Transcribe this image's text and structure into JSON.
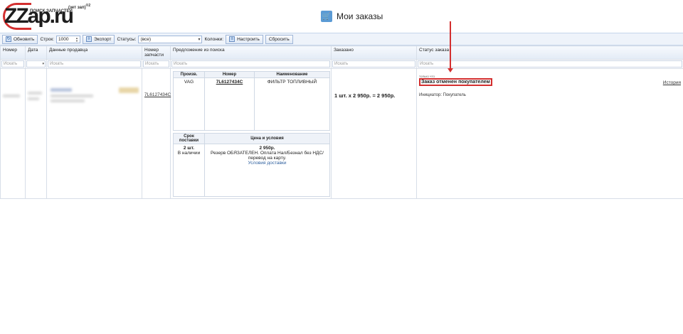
{
  "logo": {
    "brand": "ZZap.ru",
    "tagline": "ПОИСК ЗАПЧАСТЕЙ",
    "zet": "(зет зап)",
    "superscript": "®2"
  },
  "page": {
    "title": "Мои заказы",
    "cart_icon": "cart-icon"
  },
  "toolbar": {
    "refresh_label": "Обновить",
    "rows_label": "Строк:",
    "rows_value": "1000",
    "export_label": "Экспорт",
    "statuses_label": "Статусы:",
    "statuses_value": "(все)",
    "columns_label": "Колонки:",
    "configure_label": "Настроить",
    "reset_label": "Сбросить"
  },
  "table": {
    "headers": {
      "number": "Номер",
      "date": "Дата",
      "seller": "Данные продавца",
      "part_number": "Номер запчасти",
      "offer": "Предложение из поиска",
      "ordered": "Заказано",
      "status": "Статус заказа"
    },
    "filter_placeholder": "Искать",
    "row": {
      "part_number": "7L6127434C",
      "offer": {
        "h_brand": "Произв.",
        "h_number": "Номер",
        "h_name": "Наименование",
        "brand": "VAG",
        "number": "7L6127434C",
        "name": "ФИЛЬТР ТОПЛИВНЫЙ",
        "h_delivery": "Срок поставки",
        "h_price": "Цена и условия",
        "qty": "2 шт.",
        "availability": "В наличии",
        "price": "2 950р.",
        "conditions": "Резерв ОБЯЗАТЕЛЕН. Оплата Нал/Безнал без НДС/перевод на карту.",
        "delivery_link": "Условия доставки"
      },
      "ordered": "1 шт.   x   2 950р. = 2 950р.",
      "status_time": "только что",
      "status": "Заказ отменен покупателем",
      "initiator": "Инициатор: Покупатель",
      "history_link": "История"
    }
  },
  "colors": {
    "accent": "#5b9bd5",
    "annotation": "#d32f2f",
    "header_bg": "#e3ebf6"
  }
}
